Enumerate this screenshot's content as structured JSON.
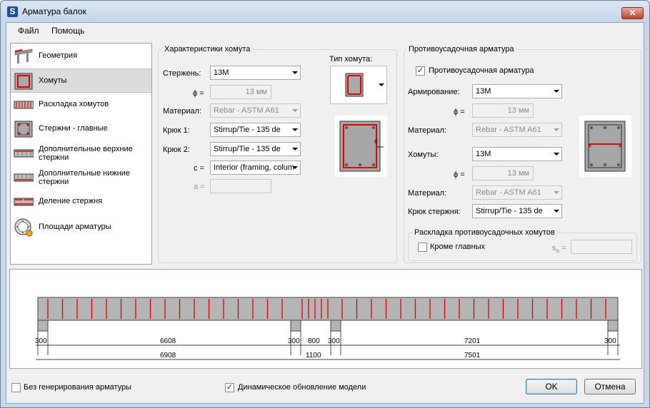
{
  "window": {
    "title": "Арматура балок",
    "app_icon": "S",
    "close_label": "✕"
  },
  "menu": [
    "Файл",
    "Помощь"
  ],
  "nav": [
    {
      "label": "Геометрия",
      "icon": "geometry-icon"
    },
    {
      "label": "Хомуты",
      "icon": "stirrup-icon"
    },
    {
      "label": "Раскладка хомутов",
      "icon": "stirrup-layout-icon"
    },
    {
      "label": "Стержни - главные",
      "icon": "main-bars-icon"
    },
    {
      "label": "Дополнительные верхние стержни",
      "icon": "top-bars-icon"
    },
    {
      "label": "Дополнительные нижние стержни",
      "icon": "bottom-bars-icon"
    },
    {
      "label": "Деление стержня",
      "icon": "bar-split-icon"
    },
    {
      "label": "Площади арматуры",
      "icon": "rebar-area-icon"
    }
  ],
  "stirrup": {
    "group_title": "Характеристики хомута",
    "bar_label": "Стержень:",
    "bar_value": "13M",
    "phi_label": "ϕ =",
    "phi_value": "13 мм",
    "material_label": "Материал:",
    "material_value": "Rebar - ASTM A61",
    "hook1_label": "Крюк 1:",
    "hook1_value": "Stirrup/Tie - 135 de",
    "hook2_label": "Крюк 2:",
    "hook2_value": "Stirrup/Tie - 135 de",
    "c_label": "c =",
    "c_value": "Interior (framing, colum",
    "a_label": "a =",
    "a_value": "",
    "type_label": "Тип хомута:",
    "section_c_label": "c"
  },
  "shrinkage": {
    "group_title": "Противоусадочная арматура",
    "enable_label": "Противоусадочная арматура",
    "enable_checked": true,
    "reinf_label": "Армирование:",
    "reinf_value": "13M",
    "phi1_label": "ϕ =",
    "phi1_value": "13 мм",
    "material1_label": "Материал:",
    "material1_value": "Rebar - ASTM A61",
    "stirrups_label": "Хомуты:",
    "stirrups_value": "13M",
    "phi2_label": "ϕ =",
    "phi2_value": "13 мм",
    "material2_label": "Материал:",
    "material2_value": "Rebar - ASTM A61",
    "hook_label": "Крюк стержня:",
    "hook_value": "Stirrup/Tie - 135 de",
    "layout_group_title": "Раскладка противоусадочных хомутов",
    "except_main_label": "Кроме главных",
    "except_main_checked": false,
    "sa_label": "s",
    "sa_sub": "a",
    "sa_eq": "=",
    "sa_value": ""
  },
  "preview": {
    "dims_row1": [
      "300",
      "6608",
      "300",
      "800",
      "300",
      "7201",
      "300"
    ],
    "dims_row2": [
      "6908",
      "1100",
      "7501"
    ]
  },
  "footer": {
    "no_gen_label": "Без генерирования арматуры",
    "no_gen_checked": false,
    "dynamic_label": "Динамическое обновление модели",
    "dynamic_checked": true,
    "ok_label": "OK",
    "cancel_label": "Отмена"
  },
  "colors": {
    "accent_red": "#e00000",
    "selection": "#dcdcdc"
  }
}
